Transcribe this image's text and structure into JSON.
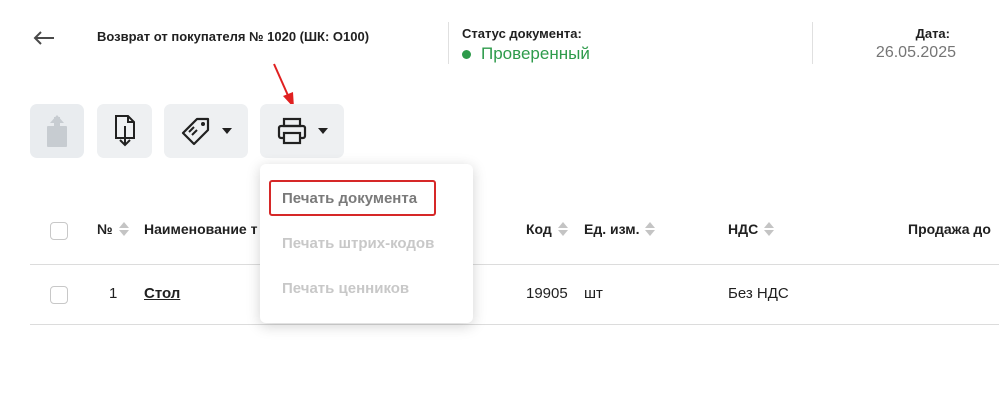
{
  "header": {
    "title": "Возврат от покупателя № 1020 (ШК: O100)",
    "status_label": "Статус документа:",
    "status_value": "Проверенный",
    "date_label": "Дата:",
    "date_value": "26.05.2025"
  },
  "toolbar": {
    "buttons": [
      {
        "icon": "share-icon",
        "state": "disabled"
      },
      {
        "icon": "download-document-icon",
        "state": "enabled"
      },
      {
        "icon": "price-tag-icon",
        "has_dropdown": true
      },
      {
        "icon": "printer-icon",
        "has_dropdown": true,
        "open": true
      }
    ]
  },
  "print_menu": {
    "items": [
      {
        "label": "Печать документа",
        "state": "active"
      },
      {
        "label": "Печать штрих-кодов",
        "state": "disabled"
      },
      {
        "label": "Печать ценников",
        "state": "disabled"
      }
    ]
  },
  "table": {
    "columns": [
      "№",
      "Наименование т",
      "Код",
      "Ед. изм.",
      "НДС",
      "Продажа до"
    ],
    "rows": [
      {
        "num": "1",
        "name": "Стол",
        "code": "19905",
        "unit": "шт",
        "vat": "Без НДС"
      }
    ]
  },
  "colors": {
    "status_green": "#2e9b4b",
    "highlight_red": "#d62828",
    "button_bg": "#eef0f2"
  }
}
